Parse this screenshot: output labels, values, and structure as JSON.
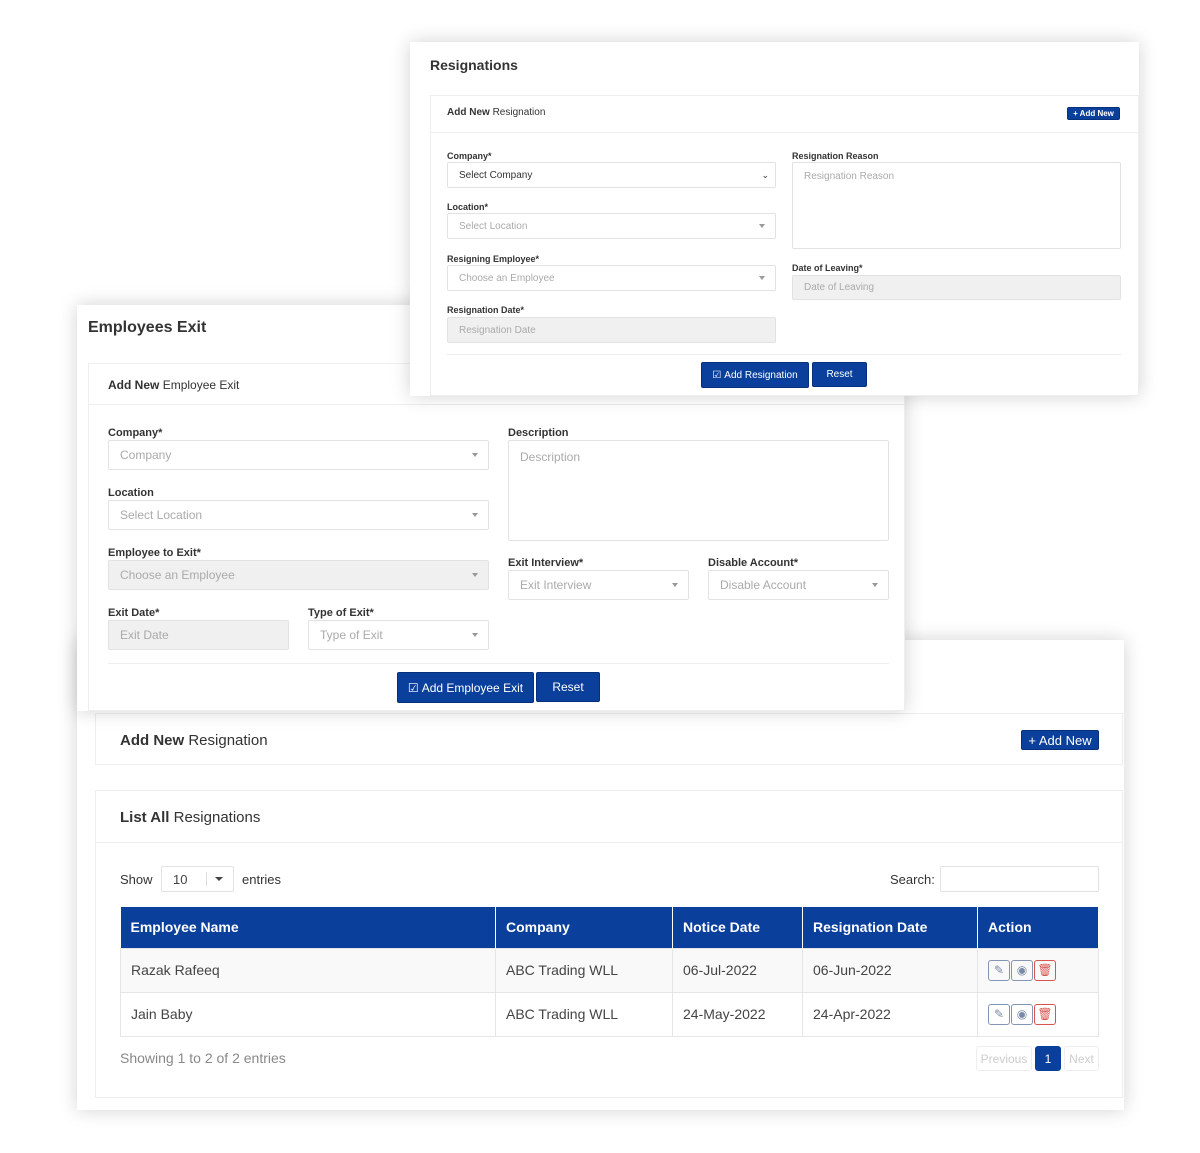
{
  "list_card": {
    "add_panel": {
      "title_bold": "Add New",
      "title_rest": "Resignation",
      "add_button": "+ Add New"
    },
    "list_panel": {
      "title_bold": "List All",
      "title_rest": "Resignations"
    },
    "show_label": "Show",
    "entries_value": "10",
    "entries_label": "entries",
    "search_label": "Search:",
    "search_value": "",
    "columns": [
      "Employee Name",
      "Company",
      "Notice Date",
      "Resignation Date",
      "Action"
    ],
    "rows": [
      {
        "name": "Razak Rafeeq",
        "company": "ABC Trading WLL",
        "notice": "06-Jul-2022",
        "resignation": "06-Jun-2022"
      },
      {
        "name": "Jain Baby",
        "company": "ABC Trading WLL",
        "notice": "24-May-2022",
        "resignation": "24-Apr-2022"
      }
    ],
    "actions": {
      "edit": "pencil-icon",
      "view": "eye-icon",
      "delete": "trash-icon"
    },
    "info": "Showing 1 to 2 of 2 entries",
    "pagination": {
      "previous": "Previous",
      "page": "1",
      "next": "Next"
    }
  },
  "exit_card": {
    "title": "Employees Exit",
    "panel_bold": "Add New",
    "panel_rest": "Employee Exit",
    "company_label": "Company*",
    "company_placeholder": "Company",
    "location_label": "Location",
    "location_placeholder": "Select Location",
    "employee_label": "Employee to Exit*",
    "employee_placeholder": "Choose an Employee",
    "exit_date_label": "Exit Date*",
    "exit_date_placeholder": "Exit Date",
    "type_label": "Type of Exit*",
    "type_placeholder": "Type of Exit",
    "description_label": "Description",
    "description_placeholder": "Description",
    "interview_label": "Exit Interview*",
    "interview_placeholder": "Exit Interview",
    "disable_label": "Disable Account*",
    "disable_placeholder": "Disable Account",
    "submit": "Add Employee Exit",
    "reset": "Reset"
  },
  "resignation_card": {
    "title": "Resignations",
    "panel_bold": "Add New",
    "panel_rest": "Resignation",
    "add_button": "+ Add New",
    "company_label": "Company*",
    "company_value": "Select Company",
    "location_label": "Location*",
    "location_placeholder": "Select Location",
    "employee_label": "Resigning Employee*",
    "employee_placeholder": "Choose an Employee",
    "date_label": "Resignation Date*",
    "date_placeholder": "Resignation Date",
    "reason_label": "Resignation Reason",
    "reason_placeholder": "Resignation Reason",
    "leaving_label": "Date of Leaving*",
    "leaving_placeholder": "Date of Leaving",
    "submit": "Add Resignation",
    "reset": "Reset"
  },
  "colors": {
    "primary": "#0a3f9c",
    "danger": "#d9534f"
  }
}
